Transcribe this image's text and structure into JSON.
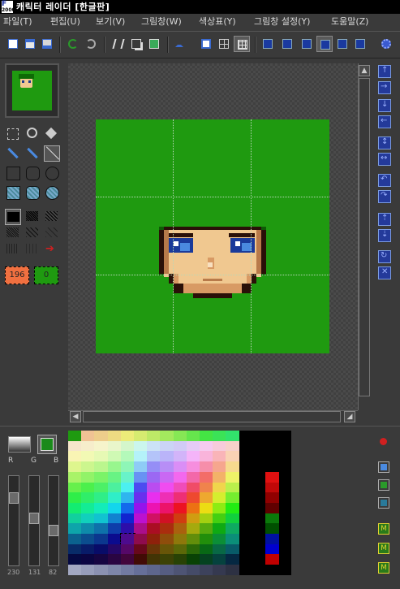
{
  "app": {
    "title": "캐릭터 레이더 [한글판]",
    "icon_letter": "F",
    "icon_year": "2000"
  },
  "menu": [
    {
      "label": "파일(T)"
    },
    {
      "label": "편집(U)"
    },
    {
      "label": "보기(V)"
    },
    {
      "label": "그림창(W)"
    },
    {
      "label": "색상표(Y)"
    },
    {
      "label": "그림창 설정(Y)"
    },
    {
      "label": "도움말(Z)"
    }
  ],
  "toolbar": {
    "icons": [
      "new-icon",
      "open-icon",
      "save-icon",
      "undo-icon",
      "redo-icon",
      "cut-icon",
      "copy-icon",
      "paste-icon",
      "text-icon",
      "frame-icon",
      "grid-icon",
      "grid-fine-icon",
      "sprite-a-icon",
      "sprite-b-icon",
      "sprite-c-icon",
      "sprite-d-icon",
      "sprite-e-icon",
      "sprite-f-icon",
      "settings-icon"
    ]
  },
  "colors": {
    "canvas_green": "#1f9a10",
    "skin": "#f0c890",
    "skin_shadow": "#d89a64",
    "hair_dark": "#0e5a05",
    "outline": "#2a1008",
    "eye_blue": "#1a3a9a",
    "foreground_color_box": "#f07040",
    "background_color_box": "#1f9a10"
  },
  "tools": {
    "fg_value": "196",
    "bg_value": "0"
  },
  "rgb_sliders": {
    "labels": [
      "R",
      "G",
      "B"
    ],
    "values": [
      "230",
      "131",
      "82"
    ]
  }
}
